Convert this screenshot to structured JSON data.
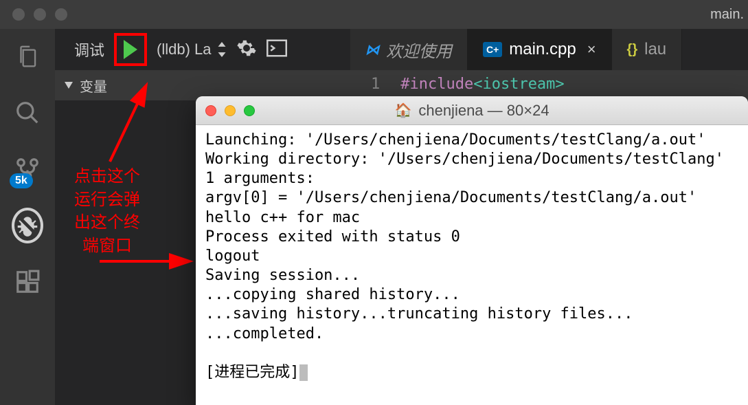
{
  "titlebar": {
    "filename": "main."
  },
  "debug_toolbar": {
    "label": "调试",
    "config": "(lldb) La"
  },
  "vars_section": {
    "title": "变量"
  },
  "tabs": {
    "welcome": "欢迎使用",
    "main": "main.cpp",
    "launch": "lau"
  },
  "code": {
    "line_number": "1",
    "include_kw": "#include",
    "header": "<iostream>"
  },
  "annotation": {
    "line1": "点击这个",
    "line2": "运行会弹",
    "line3": "出这个终",
    "line4": "端窗口"
  },
  "terminal": {
    "title": "chenjiena — 80×24",
    "lines": [
      "Launching: '/Users/chenjiena/Documents/testClang/a.out'",
      "Working directory: '/Users/chenjiena/Documents/testClang'",
      "1 arguments:",
      "argv[0] = '/Users/chenjiena/Documents/testClang/a.out'",
      "hello c++ for mac",
      "Process exited with status 0",
      "logout",
      "Saving session...",
      "...copying shared history...",
      "...saving history...truncating history files...",
      "...completed.",
      "",
      "[进程已完成]"
    ]
  },
  "badge_5k": "5k"
}
